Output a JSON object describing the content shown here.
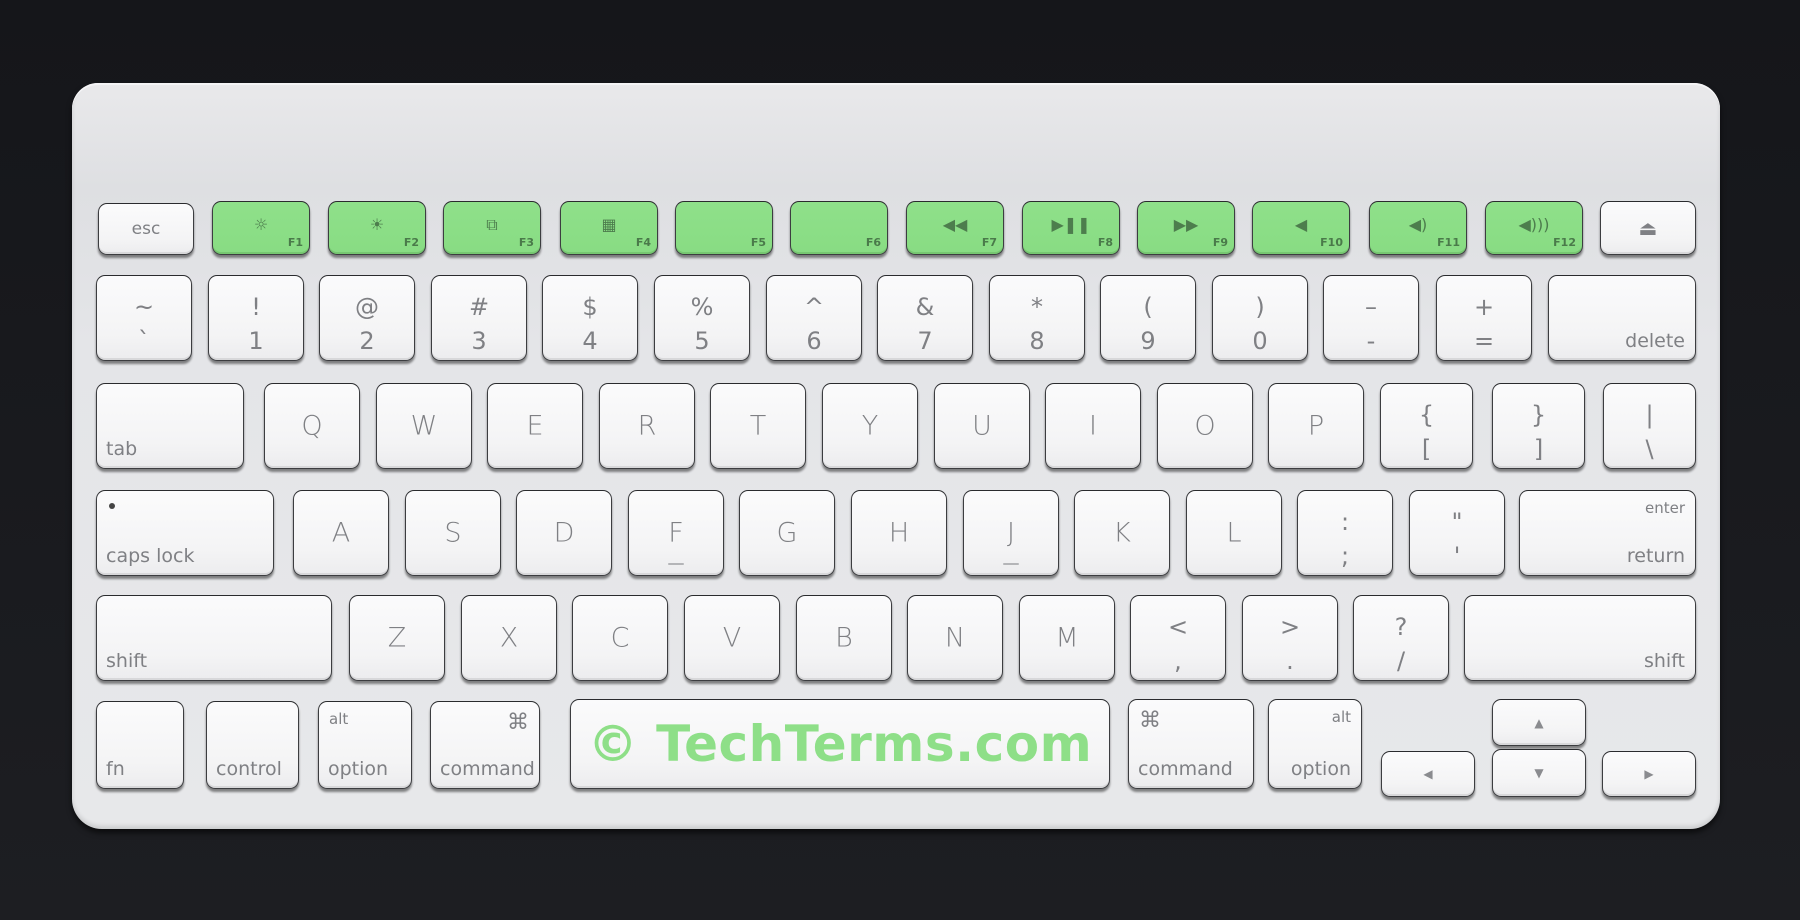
{
  "photo": {
    "subject": "Apple Wireless Keyboard",
    "watermark": "© TechTerms.com",
    "highlight_color": "#8ee089"
  },
  "keys": {
    "esc": "esc",
    "eject": "⏏",
    "function_row": [
      {
        "label": "F1",
        "icon": "☼"
      },
      {
        "label": "F2",
        "icon": "☀"
      },
      {
        "label": "F3",
        "icon": "⧉"
      },
      {
        "label": "F4",
        "icon": "▦"
      },
      {
        "label": "F5",
        "icon": ""
      },
      {
        "label": "F6",
        "icon": ""
      },
      {
        "label": "F7",
        "icon": "◀◀"
      },
      {
        "label": "F8",
        "icon": "▶❚❚"
      },
      {
        "label": "F9",
        "icon": "▶▶"
      },
      {
        "label": "F10",
        "icon": "◀"
      },
      {
        "label": "F11",
        "icon": "◀)"
      },
      {
        "label": "F12",
        "icon": "◀)))"
      }
    ],
    "number_row": [
      {
        "top": "~",
        "bottom": "`"
      },
      {
        "top": "!",
        "bottom": "1"
      },
      {
        "top": "@",
        "bottom": "2"
      },
      {
        "top": "#",
        "bottom": "3"
      },
      {
        "top": "$",
        "bottom": "4"
      },
      {
        "top": "%",
        "bottom": "5"
      },
      {
        "top": "^",
        "bottom": "6"
      },
      {
        "top": "&",
        "bottom": "7"
      },
      {
        "top": "*",
        "bottom": "8"
      },
      {
        "top": "(",
        "bottom": "9"
      },
      {
        "top": ")",
        "bottom": "0"
      },
      {
        "top": "–",
        "bottom": "-"
      },
      {
        "top": "+",
        "bottom": "="
      }
    ],
    "delete": "delete",
    "tab": "tab",
    "qwerty_row": [
      "Q",
      "W",
      "E",
      "R",
      "T",
      "Y",
      "U",
      "I",
      "O",
      "P"
    ],
    "bracket_keys": [
      {
        "top": "{",
        "bottom": "["
      },
      {
        "top": "}",
        "bottom": "]"
      },
      {
        "top": "|",
        "bottom": "\\"
      }
    ],
    "caps_lock": "caps lock",
    "home_row": [
      "A",
      "S",
      "D",
      "F",
      "G",
      "H",
      "J",
      "K",
      "L"
    ],
    "home_punct": [
      {
        "top": ":",
        "bottom": ";"
      },
      {
        "top": "\"",
        "bottom": "'"
      }
    ],
    "enter": "enter",
    "return": "return",
    "shift_left": "shift",
    "bottom_letters": [
      "Z",
      "X",
      "C",
      "V",
      "B",
      "N",
      "M"
    ],
    "bottom_punct": [
      {
        "top": "<",
        "bottom": ","
      },
      {
        "top": ">",
        "bottom": "."
      },
      {
        "top": "?",
        "bottom": "/"
      }
    ],
    "shift_right": "shift",
    "fn": "fn",
    "control": "control",
    "alt": "alt",
    "option": "option",
    "command": "command",
    "command_symbol": "⌘",
    "arrow_up": "▲",
    "arrow_down": "▼",
    "arrow_left": "◀",
    "arrow_right": "▶"
  }
}
